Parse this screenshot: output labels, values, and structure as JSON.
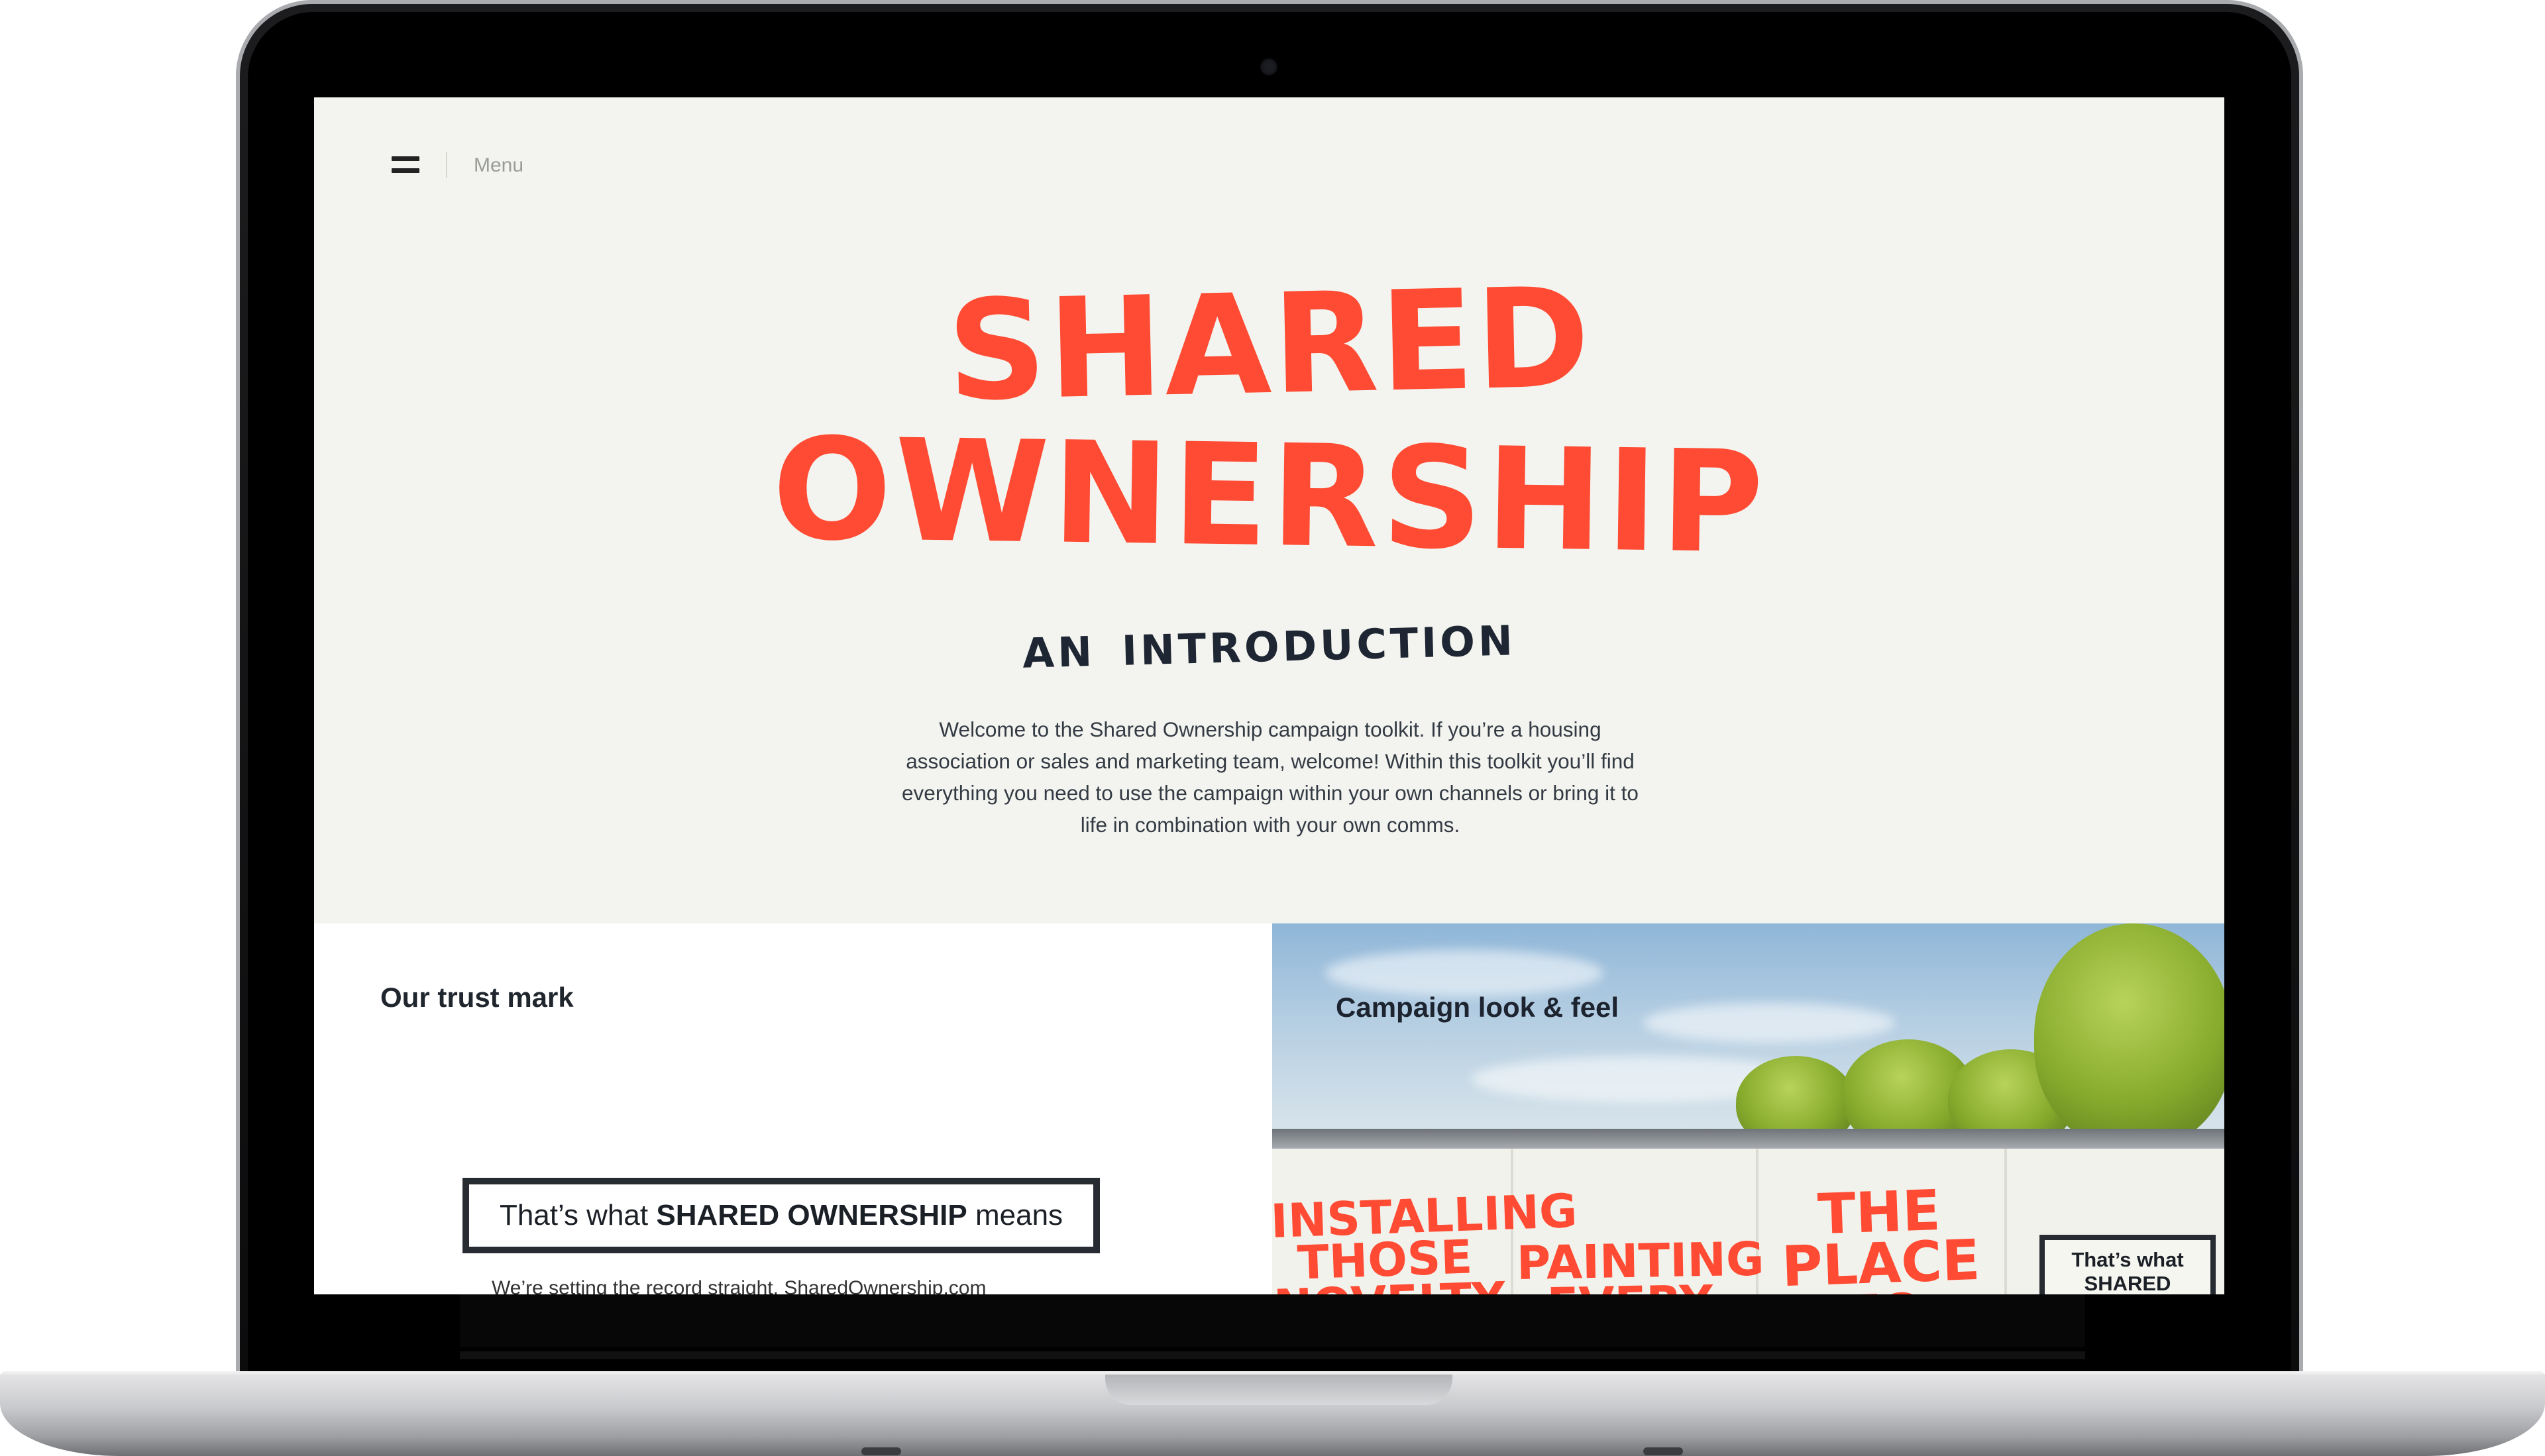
{
  "menu": {
    "label": "Menu"
  },
  "hero": {
    "line1": "SHARED",
    "line2": "OWNERSHIP"
  },
  "subtitle": {
    "word1": "AN",
    "word2": "INTRODUCTION"
  },
  "intro": {
    "text": "Welcome to the Shared Ownership campaign toolkit. If you’re a housing association or sales and marketing team, welcome! Within this toolkit you’ll find everything you need to use the campaign within your own channels or bring it to life in combination with your own comms."
  },
  "trust_card": {
    "heading": "Our trust mark",
    "badge_prefix": "That’s what ",
    "badge_strong": "SHARED OWNERSHIP",
    "badge_suffix": " means",
    "text": "We’re setting the record straight. SharedOwnership.com"
  },
  "campaign_card": {
    "heading": "Campaign look & feel",
    "posters": [
      "INSTALLING THOSE NOVELTY",
      "PAINTING EVERY WALL",
      "THE PLACE TO YOURSELF"
    ],
    "mini_badge": "That’s what SHARED"
  },
  "colors": {
    "accent": "#ff4b33",
    "text_dark": "#1f2633",
    "screen_bg": "#f3f4ef"
  }
}
